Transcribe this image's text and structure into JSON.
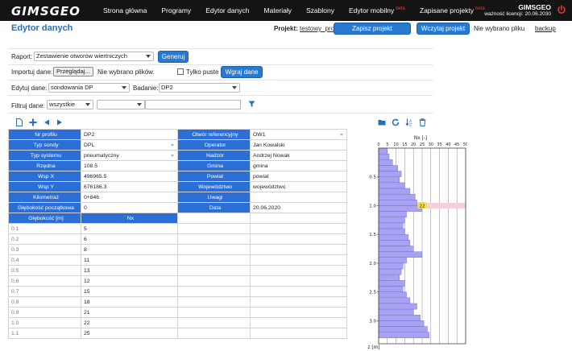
{
  "app": {
    "logo": "GIMSGEO",
    "nav": [
      {
        "label": "Strona główna",
        "beta": ""
      },
      {
        "label": "Programy",
        "beta": ""
      },
      {
        "label": "Edytor danych",
        "beta": ""
      },
      {
        "label": "Materiały",
        "beta": ""
      },
      {
        "label": "Szablony",
        "beta": ""
      },
      {
        "label": "Edytor mobilny",
        "beta": "beta"
      },
      {
        "label": "Zapisane projekty",
        "beta": "beta"
      }
    ],
    "user": "GIMSGEO",
    "license": "ważność licencji: 20.06.2030"
  },
  "header": {
    "title": "Edytor danych",
    "project_label": "Projekt:",
    "project_name": "testowy_projekt",
    "save_btn": "Zapisz projekt",
    "load_btn": "Wczytaj projekt",
    "no_file": "Nie wybrano pliku",
    "backup": "backup"
  },
  "form": {
    "report_label": "Raport:",
    "report_value": "Zestawienie otworów wiertniczych",
    "generate_btn": "Generuj",
    "import_label": "Importuj dane:",
    "browse_btn": "Przeglądaj...",
    "no_files": "Nie wybrano plików.",
    "only_empty": "Tylko puste",
    "load_data_btn": "Wgraj dane",
    "edit_label": "Edytuj dane:",
    "edit_value": "sondowania DP",
    "study_label": "Badanie:",
    "study_value": "DP2",
    "filter_label": "Filtruj dane:",
    "filter_value": "wszystkie"
  },
  "props": [
    {
      "l1": "Nr profilu",
      "v1": "DP2",
      "a1": false,
      "l2": "Otwór referencyjny",
      "v2": "OW1",
      "a2": true
    },
    {
      "l1": "Typ sondy",
      "v1": "DPL",
      "a1": true,
      "l2": "Operator",
      "v2": "Jan Kowalski",
      "a2": false
    },
    {
      "l1": "Typ systemu",
      "v1": "pneumatyczny",
      "a1": true,
      "l2": "Nadzór",
      "v2": "Andrzej Nowak",
      "a2": false
    },
    {
      "l1": "Rzędna",
      "v1": "108.5",
      "a1": false,
      "l2": "Gmina",
      "v2": "gmina",
      "a2": false
    },
    {
      "l1": "Wsp X",
      "v1": "496965.5",
      "a1": false,
      "l2": "Powiat",
      "v2": "powiat",
      "a2": false
    },
    {
      "l1": "Wsp Y",
      "v1": "676186.3",
      "a1": false,
      "l2": "Województwo",
      "v2": "województwo",
      "a2": false
    },
    {
      "l1": "Kilometraż",
      "v1": "0+846",
      "a1": false,
      "l2": "Uwagi",
      "v2": "",
      "a2": false
    },
    {
      "l1": "Głębokość początkowa",
      "v1": "0",
      "a1": false,
      "l2": "Data",
      "v2": "20.06.2020",
      "a2": false
    }
  ],
  "data_headers": {
    "depth": "Głębokość [m]",
    "nx": "Nx"
  },
  "rows": [
    {
      "depth": "0.1",
      "nx": "5"
    },
    {
      "depth": "0.2",
      "nx": "6"
    },
    {
      "depth": "0.3",
      "nx": "8"
    },
    {
      "depth": "0.4",
      "nx": "11"
    },
    {
      "depth": "0.5",
      "nx": "13"
    },
    {
      "depth": "0.6",
      "nx": "12"
    },
    {
      "depth": "0.7",
      "nx": "15"
    },
    {
      "depth": "0.8",
      "nx": "18"
    },
    {
      "depth": "0.9",
      "nx": "21"
    },
    {
      "depth": "1.0",
      "nx": "22"
    },
    {
      "depth": "1.1",
      "nx": "25"
    }
  ],
  "chart_data": {
    "type": "bar",
    "orientation": "horizontal",
    "xlabel": "Nx [-]",
    "ylabel": "z [m]",
    "xlim": [
      0,
      50
    ],
    "xticks": [
      0,
      5,
      10,
      15,
      20,
      25,
      30,
      35,
      40,
      45,
      50
    ],
    "ylim": [
      0,
      3.4
    ],
    "yticks": [
      "0.5",
      "1.0",
      "1.5",
      "2.0",
      "2.5",
      "3.0"
    ],
    "depths": [
      0.1,
      0.2,
      0.3,
      0.4,
      0.5,
      0.6,
      0.7,
      0.8,
      0.9,
      1.0,
      1.1,
      1.2,
      1.3,
      1.4,
      1.5,
      1.6,
      1.7,
      1.8,
      1.9,
      2.0,
      2.1,
      2.2,
      2.3,
      2.4,
      2.5,
      2.6,
      2.7,
      2.8,
      2.9,
      3.0,
      3.1,
      3.2,
      3.3
    ],
    "values": [
      5,
      6,
      8,
      11,
      13,
      12,
      15,
      18,
      21,
      22,
      25,
      16,
      15,
      14,
      15,
      17,
      18,
      20,
      25,
      16,
      14,
      13,
      12,
      15,
      14,
      16,
      18,
      22,
      20,
      24,
      26,
      28,
      29
    ],
    "highlight": {
      "depth": 1.0,
      "label": "22"
    },
    "colors": {
      "bar": "#a7a3f0",
      "bar_edge": "#6b63d8",
      "highlight": "#f6cfd8",
      "label_bg": "#f4e04a"
    }
  }
}
